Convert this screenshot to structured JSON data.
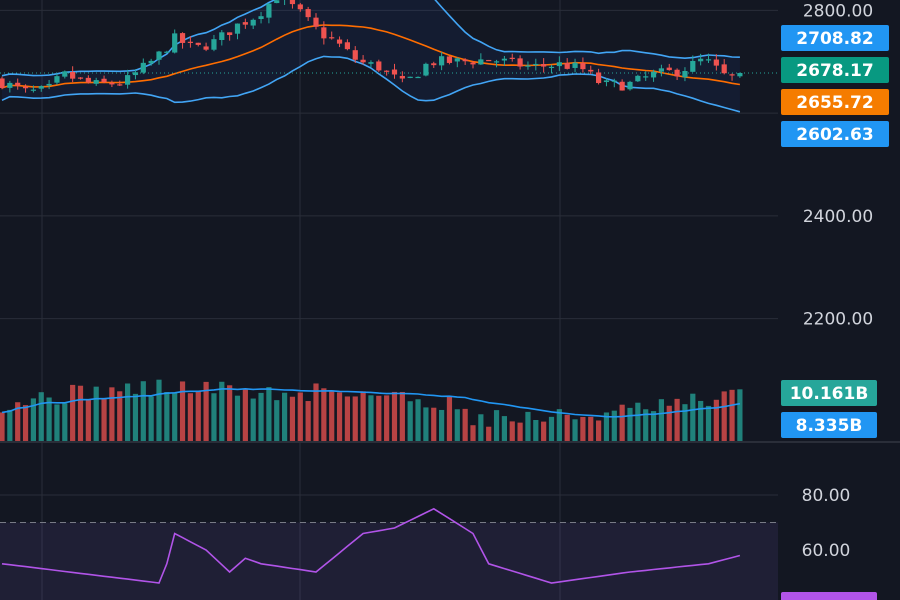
{
  "colors": {
    "background": "#131722",
    "grid": "#2a2e39",
    "axis_text": "#d1d4dc",
    "bull": "#26a69a",
    "bear": "#ef5350",
    "bollinger_band": "#2962ff",
    "bollinger_line": "#42a5f5",
    "bollinger_basis": "#ff6d00",
    "volume_ma": "#2196f3",
    "rsi_line": "#b154e8",
    "rsi_band": "#7e57c2",
    "last_price_line": "#26a69a"
  },
  "chart_data": [
    {
      "type": "candlestick",
      "pane": "price",
      "price_axis_ticks": [
        "2800.00",
        "2400.00",
        "2200.00"
      ],
      "ylim": [
        2100,
        2830
      ],
      "overlays": {
        "bollinger_upper": 2708.82,
        "bollinger_basis": 2655.72,
        "bollinger_lower": 2602.63
      },
      "last_price": 2678.17,
      "badges": [
        {
          "label": "2708.82",
          "value": 2708.82,
          "color": "#2196f3"
        },
        {
          "label": "2678.17",
          "value": 2678.17,
          "color": "#089981"
        },
        {
          "label": "2655.72",
          "value": 2655.72,
          "color": "#f57c00"
        },
        {
          "label": "2602.63",
          "value": 2602.63,
          "color": "#2196f3"
        }
      ]
    },
    {
      "type": "bar",
      "pane": "volume",
      "badges": [
        {
          "label": "10.161B",
          "color": "#26a69a"
        },
        {
          "label": "8.335B",
          "color": "#2196f3"
        }
      ]
    },
    {
      "type": "line",
      "pane": "rsi",
      "ylim": [
        20,
        100
      ],
      "axis_ticks": [
        "80.00",
        "60.00"
      ],
      "overbought": 70
    }
  ]
}
